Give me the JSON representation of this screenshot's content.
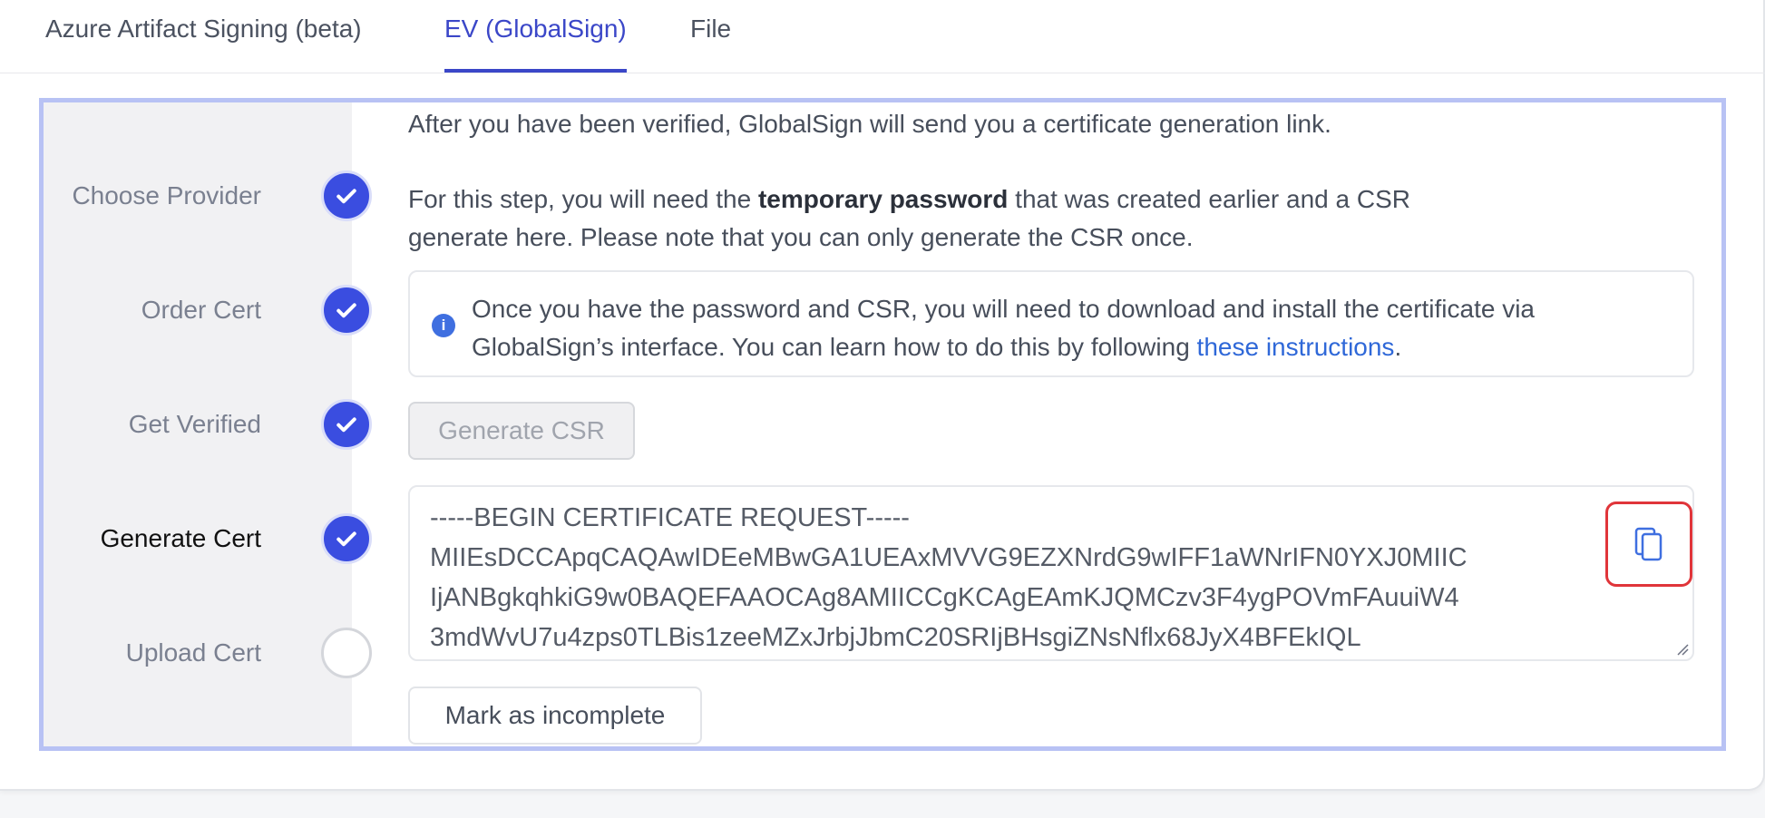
{
  "tabs": [
    {
      "label": "Azure Artifact Signing (beta)"
    },
    {
      "label": "EV (GlobalSign)"
    },
    {
      "label": "File"
    }
  ],
  "steps": [
    {
      "label": "Choose Provider",
      "status": "complete"
    },
    {
      "label": "Order Cert",
      "status": "complete"
    },
    {
      "label": "Get Verified",
      "status": "complete"
    },
    {
      "label": "Generate Cert",
      "status": "complete",
      "current": true
    },
    {
      "label": "Upload Cert",
      "status": "incomplete"
    }
  ],
  "content": {
    "intro": "After you have been verified, GlobalSign will send you a certificate generation link.",
    "step_prefix": "For this step, you will need the ",
    "step_bold": "temporary password",
    "step_suffix": " that was created earlier and a CSR",
    "step_line2": "generate here. Please note that you can only generate the CSR once.",
    "info_line1": "Once you have the password and CSR, you will need to download and install the certificate via",
    "info_line2_prefix": "GlobalSign’s interface. You can learn how to do this by following ",
    "info_link": "these instructions",
    "info_line2_suffix": ".",
    "generate_button": "Generate CSR",
    "csr_lines": [
      "-----BEGIN CERTIFICATE REQUEST-----",
      "MIIEsDCCApqCAQAwIDEeMBwGA1UEAxMVVG9EZXNrdG9wIFF1aWNrIFN0YXJ0MIIC",
      "IjANBgkqhkiG9w0BAQEFAAOCAg8AMIICCgKCAgEAmKJQMCzv3F4ygPOVmFAuuiW4",
      "3mdWvU7u4zps0TLBis1zeeMZxJrbjJbmC20SRIjBHsgiZNsNflx68JyX4BFEkIQL"
    ],
    "mark_button": "Mark as incomplete"
  },
  "colors": {
    "accent": "#3b47c8",
    "check": "#3a4de0",
    "link": "#2f68d8",
    "highlight": "#e0353a"
  }
}
